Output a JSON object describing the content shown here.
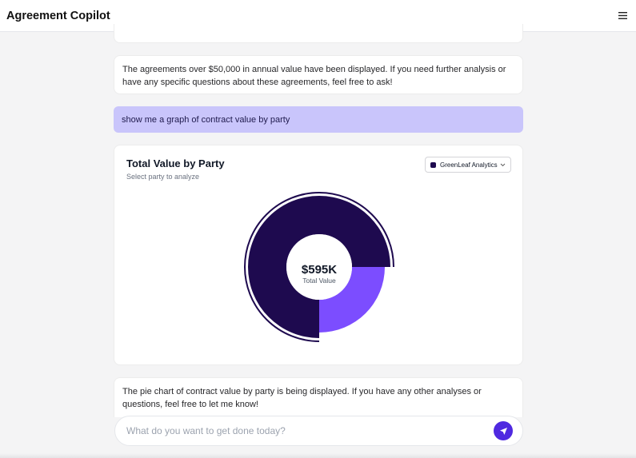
{
  "app": {
    "title": "Agreement Copilot"
  },
  "messages": {
    "assistant_1": "The agreements over $50,000 in annual value have been displayed. If you need further analysis or have any specific questions about these agreements, feel free to ask!",
    "user_1": "show me a graph of contract value by party",
    "assistant_2": "The pie chart of contract value by party is being displayed. If you have any other analyses or questions, feel free to let me know!"
  },
  "chart": {
    "title": "Total Value by Party",
    "subtitle": "Select party to analyze",
    "selected_party": "GreenLeaf Analytics I",
    "total_value": "$595K",
    "total_label": "Total Value"
  },
  "chart_data": {
    "type": "pie",
    "title": "Total Value by Party",
    "slices": [
      {
        "fraction": 0.75,
        "color": "#1e0a4f",
        "highlighted": true
      },
      {
        "fraction": 0.25,
        "color": "#7c4dff",
        "highlighted": false
      }
    ],
    "center_text": "$595K",
    "center_label": "Total Value"
  },
  "input": {
    "placeholder": "What do you want to get done today?"
  },
  "colors": {
    "accent": "#4f29e0",
    "user_bubble": "#c9c5fb",
    "slice_dark": "#1e0a4f",
    "slice_light": "#7c4dff"
  },
  "icons": {
    "menu": "hamburger-menu-icon",
    "send": "send-arrow-icon",
    "dropdown": "chevron-down-icon"
  }
}
